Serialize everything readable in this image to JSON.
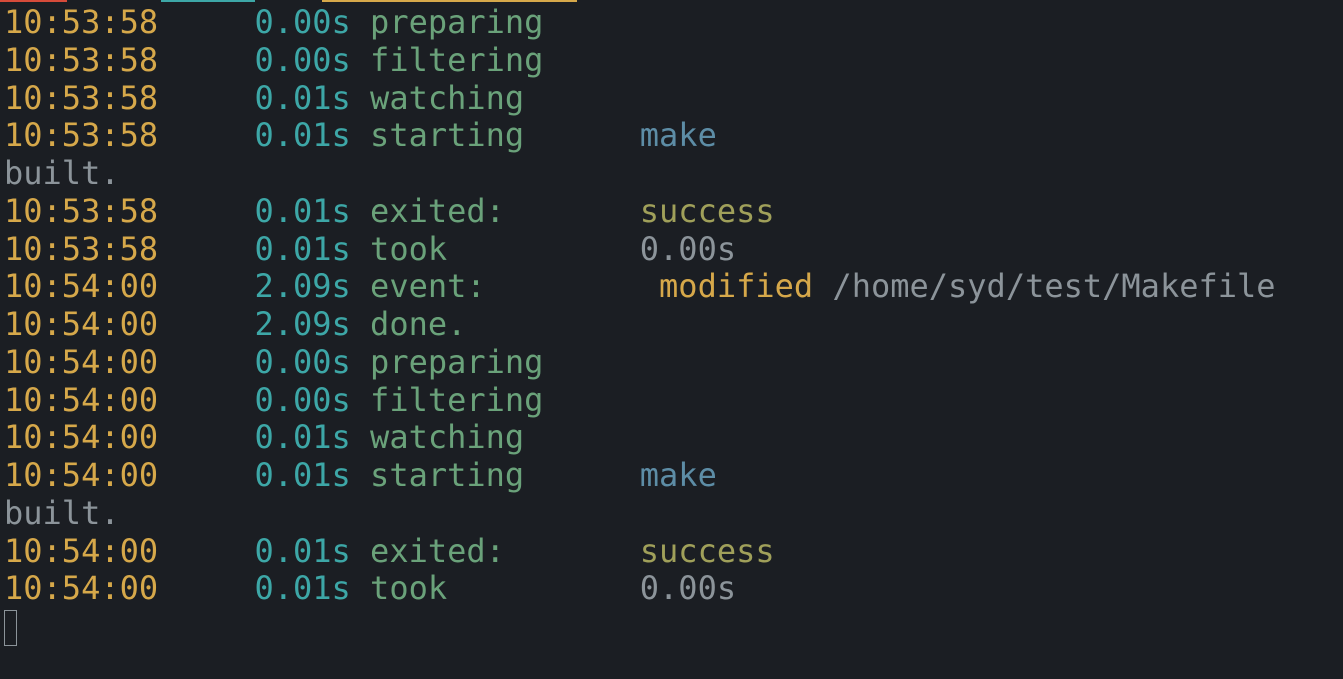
{
  "lines": [
    {
      "type": "log",
      "time": "10:53:58",
      "elapsed": "0.00s",
      "action": "preparing"
    },
    {
      "type": "log",
      "time": "10:53:58",
      "elapsed": "0.00s",
      "action": "filtering"
    },
    {
      "type": "log",
      "time": "10:53:58",
      "elapsed": "0.01s",
      "action": "watching"
    },
    {
      "type": "log",
      "time": "10:53:58",
      "elapsed": "0.01s",
      "action": "starting",
      "extra": {
        "text": "make",
        "class": "blue"
      }
    },
    {
      "type": "plain",
      "text": "built."
    },
    {
      "type": "log",
      "time": "10:53:58",
      "elapsed": "0.01s",
      "action": "exited:",
      "extra": {
        "text": "success",
        "class": "olive"
      }
    },
    {
      "type": "log",
      "time": "10:53:58",
      "elapsed": "0.01s",
      "action": "took",
      "extra": {
        "text": "0.00s",
        "class": "grey"
      }
    },
    {
      "type": "event",
      "time": "10:54:00",
      "elapsed": "2.09s",
      "action": "event:",
      "event_type": "modified",
      "event_path": "/home/syd/test/Makefile"
    },
    {
      "type": "log",
      "time": "10:54:00",
      "elapsed": "2.09s",
      "action": "done."
    },
    {
      "type": "log",
      "time": "10:54:00",
      "elapsed": "0.00s",
      "action": "preparing"
    },
    {
      "type": "log",
      "time": "10:54:00",
      "elapsed": "0.00s",
      "action": "filtering"
    },
    {
      "type": "log",
      "time": "10:54:00",
      "elapsed": "0.01s",
      "action": "watching"
    },
    {
      "type": "log",
      "time": "10:54:00",
      "elapsed": "0.01s",
      "action": "starting",
      "extra": {
        "text": "make",
        "class": "blue"
      }
    },
    {
      "type": "plain",
      "text": "built."
    },
    {
      "type": "log",
      "time": "10:54:00",
      "elapsed": "0.01s",
      "action": "exited:",
      "extra": {
        "text": "success",
        "class": "olive"
      }
    },
    {
      "type": "log",
      "time": "10:54:00",
      "elapsed": "0.01s",
      "action": "took",
      "extra": {
        "text": "0.00s",
        "class": "grey"
      }
    }
  ]
}
